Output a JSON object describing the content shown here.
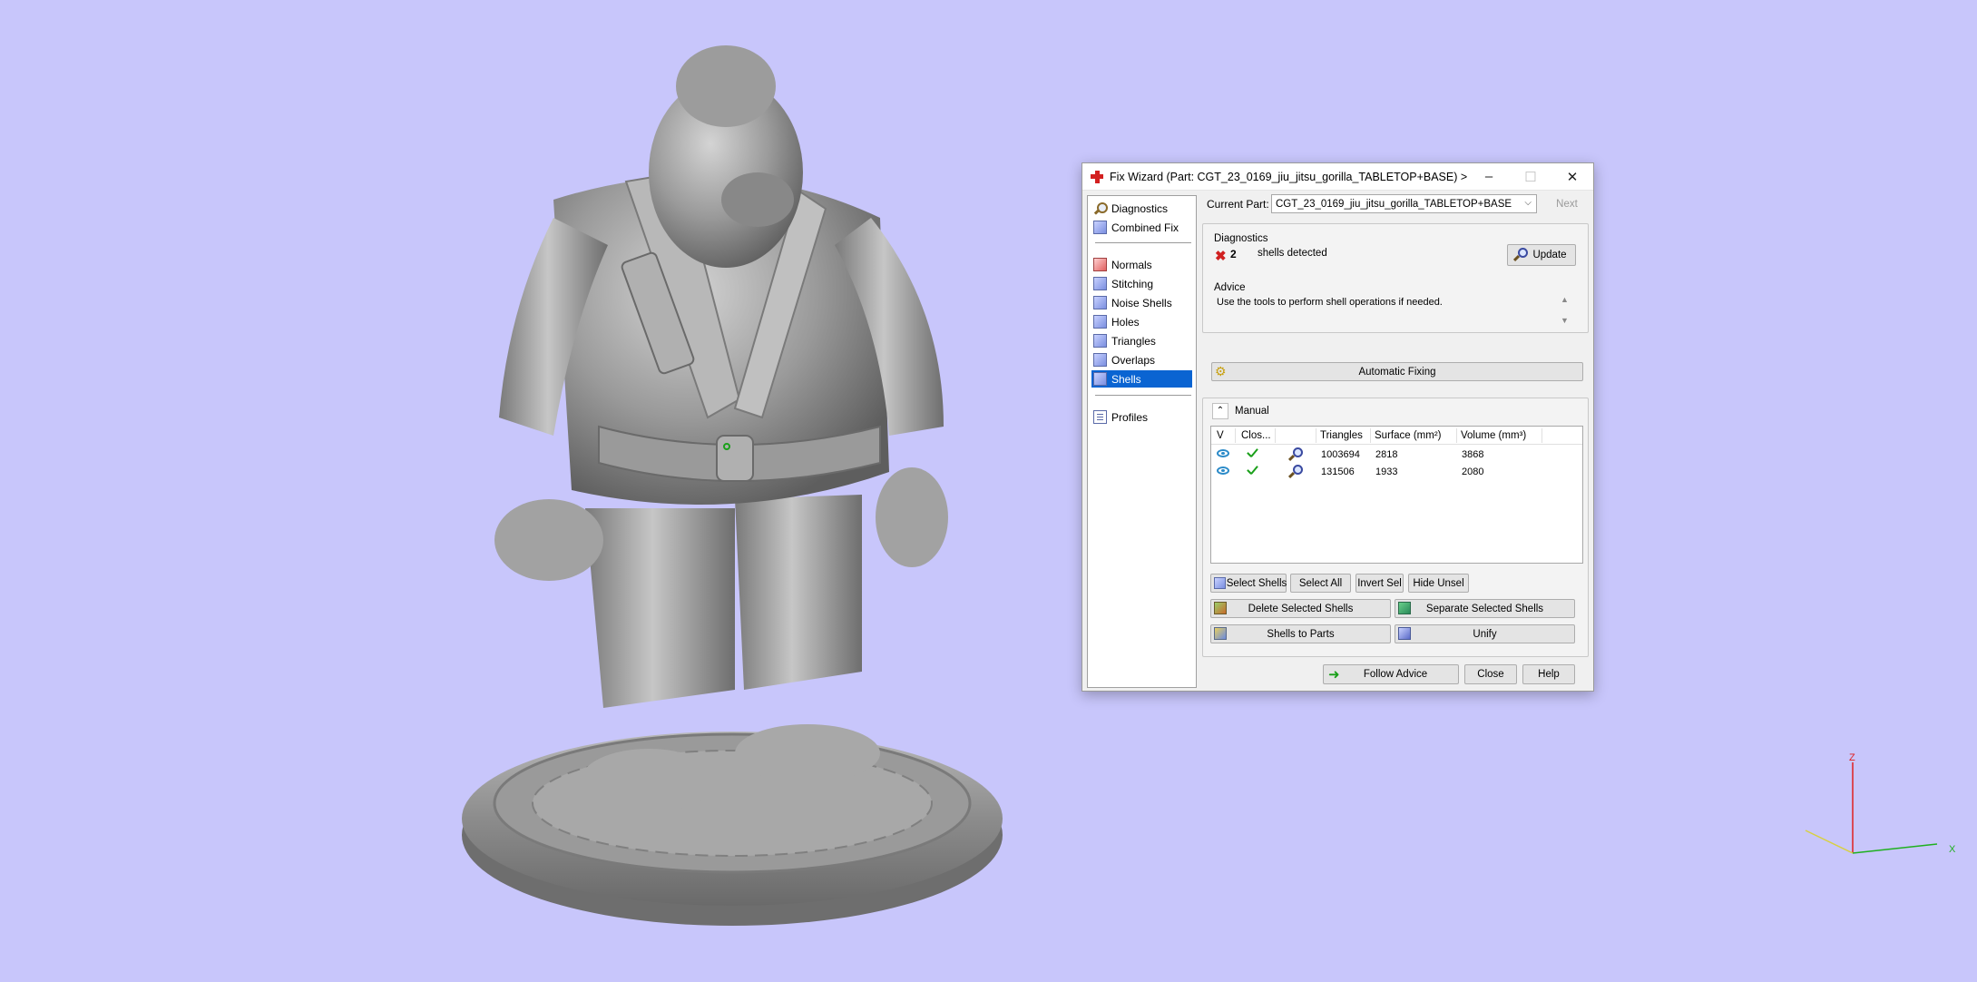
{
  "dialog": {
    "title": "Fix Wizard (Part: CGT_23_0169_jiu_jitsu_gorilla_TABLETOP+BASE) > Shells",
    "minimize": "–",
    "maximize": "☐",
    "close": "✕"
  },
  "nav": {
    "items": [
      {
        "label": "Diagnostics",
        "icon": "magnifier-icon"
      },
      {
        "label": "Combined Fix",
        "icon": "combined-fix-icon"
      },
      {
        "label": "Normals",
        "icon": "normals-icon"
      },
      {
        "label": "Stitching",
        "icon": "stitching-icon"
      },
      {
        "label": "Noise Shells",
        "icon": "noise-shells-icon"
      },
      {
        "label": "Holes",
        "icon": "holes-icon"
      },
      {
        "label": "Triangles",
        "icon": "triangles-icon"
      },
      {
        "label": "Overlaps",
        "icon": "overlaps-icon"
      },
      {
        "label": "Shells",
        "icon": "shells-icon",
        "selected": true
      },
      {
        "label": "Profiles",
        "icon": "profiles-icon"
      }
    ]
  },
  "current_part": {
    "label": "Current Part:",
    "value": "CGT_23_0169_jiu_jitsu_gorilla_TABLETOP+BASE",
    "next_label": "Next"
  },
  "diagnostics": {
    "group_label": "Diagnostics",
    "count": "2",
    "text": "shells detected",
    "update_label": "Update"
  },
  "advice": {
    "group_label": "Advice",
    "text": "Use the tools to perform shell operations if needed.",
    "automatic_fixing_label": "Automatic Fixing"
  },
  "manual": {
    "label": "Manual",
    "columns": [
      "V",
      "Clos...",
      "",
      "Triangles",
      "Surface (mm²)",
      "Volume (mm³)"
    ],
    "rows": [
      {
        "triangles": "1003694",
        "surface": "2818",
        "volume": "3868"
      },
      {
        "triangles": "131506",
        "surface": "1933",
        "volume": "2080"
      }
    ],
    "buttons": {
      "select_shells": "Select Shells",
      "select_all": "Select All",
      "invert_sel": "Invert Sel",
      "hide_unsel": "Hide Unsel",
      "delete_selected": "Delete Selected Shells",
      "separate_selected": "Separate Selected Shells",
      "shells_to_parts": "Shells to Parts",
      "unify": "Unify"
    }
  },
  "footer": {
    "follow_advice": "Follow Advice",
    "close": "Close",
    "help": "Help"
  },
  "axes": {
    "z": "Z",
    "x": "X"
  },
  "colors": {
    "background": "#c8c6fb",
    "selection": "#0a64d2",
    "model": "#8e8e8e"
  }
}
